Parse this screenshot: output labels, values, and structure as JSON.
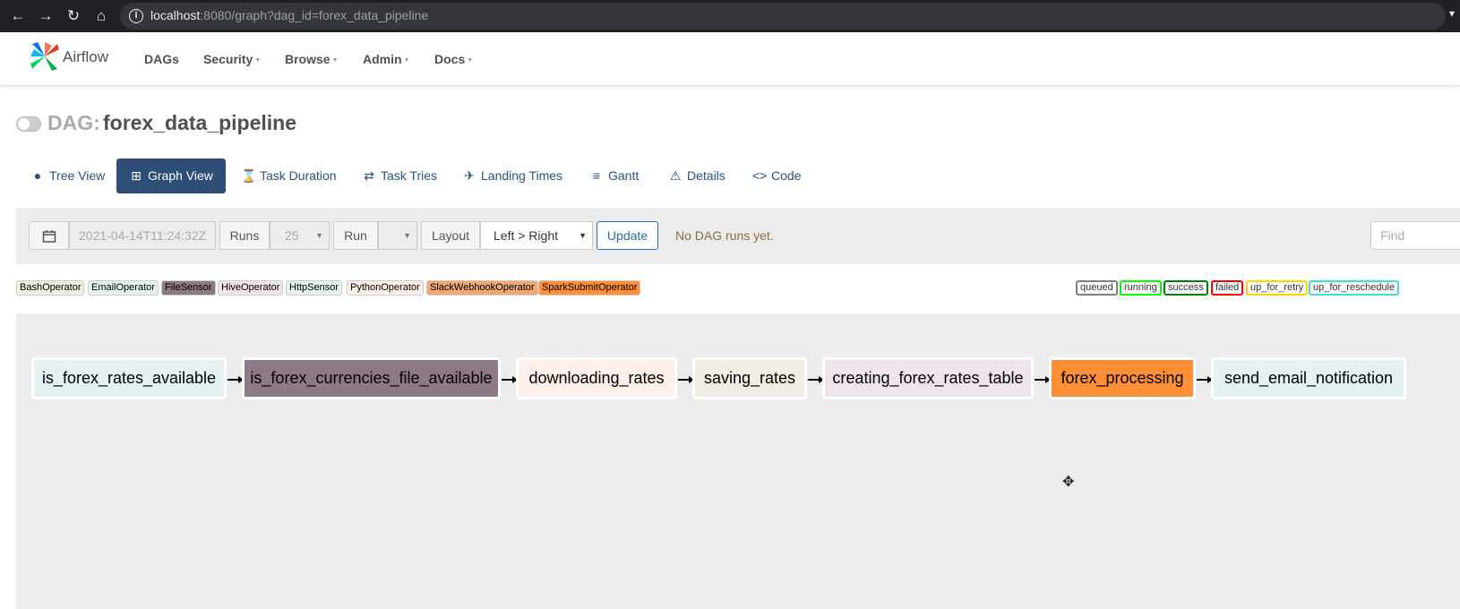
{
  "browser": {
    "url_host": "localhost",
    "url_rest": ":8080/graph?dag_id=forex_data_pipeline",
    "icons": [
      "back-icon",
      "forward-icon",
      "reload-icon",
      "home-icon",
      "info-icon"
    ]
  },
  "navbar": {
    "brand": "Airflow",
    "items": [
      {
        "label": "DAGs",
        "dropdown": false
      },
      {
        "label": "Security",
        "dropdown": true
      },
      {
        "label": "Browse",
        "dropdown": true
      },
      {
        "label": "Admin",
        "dropdown": true
      },
      {
        "label": "Docs",
        "dropdown": true
      }
    ]
  },
  "dag": {
    "prefix": "DAG:",
    "name": "forex_data_pipeline",
    "paused": true
  },
  "tabs": [
    {
      "label": "Tree View",
      "icon": "tree-icon"
    },
    {
      "label": "Graph View",
      "icon": "graph-icon",
      "active": true
    },
    {
      "label": "Task Duration",
      "icon": "hourglass-icon"
    },
    {
      "label": "Task Tries",
      "icon": "retweet-icon"
    },
    {
      "label": "Landing Times",
      "icon": "plane-icon"
    },
    {
      "label": "Gantt",
      "icon": "align-icon"
    },
    {
      "label": "Details",
      "icon": "warning-icon"
    },
    {
      "label": "Code",
      "icon": "code-icon"
    }
  ],
  "controls": {
    "base_date": "2021-04-14T11:24:32Z",
    "runs_label": "Runs",
    "runs_value": "25",
    "run_label": "Run",
    "run_value": "",
    "layout_label": "Layout",
    "layout_value": "Left > Right",
    "update_label": "Update",
    "status_message": "No DAG runs yet.",
    "find_placeholder": "Find"
  },
  "operators": [
    {
      "label": "BashOperator",
      "color": "#f0ede4"
    },
    {
      "label": "EmailOperator",
      "color": "#e6f1f2"
    },
    {
      "label": "FileSensor",
      "color": "#8e7a85"
    },
    {
      "label": "HiveOperator",
      "color": "#f0e4ec"
    },
    {
      "label": "HttpSensor",
      "color": "#e6f1f2"
    },
    {
      "label": "PythonOperator",
      "color": "#ffefeb"
    },
    {
      "label": "SlackWebhookOperator",
      "color": "#f1a873"
    },
    {
      "label": "SparkSubmitOperator",
      "color": "#ff8f36"
    }
  ],
  "states": [
    {
      "label": "queued",
      "color": "#808080"
    },
    {
      "label": "running",
      "color": "#00ff00"
    },
    {
      "label": "success",
      "color": "#008000"
    },
    {
      "label": "failed",
      "color": "#ff0000"
    },
    {
      "label": "up_for_retry",
      "color": "#ffd700"
    },
    {
      "label": "up_for_reschedule",
      "color": "#40e0d0"
    }
  ],
  "tasks": [
    {
      "label": "is_forex_rates_available",
      "color": "#e6f1f2"
    },
    {
      "label": "is_forex_currencies_file_available",
      "color": "#8e7a85"
    },
    {
      "label": "downloading_rates",
      "color": "#ffefeb"
    },
    {
      "label": "saving_rates",
      "color": "#f0ede4"
    },
    {
      "label": "creating_forex_rates_table",
      "color": "#f0e4ec"
    },
    {
      "label": "forex_processing",
      "color": "#ff8f36"
    },
    {
      "label": "send_email_notification",
      "color": "#e6f1f2"
    }
  ]
}
